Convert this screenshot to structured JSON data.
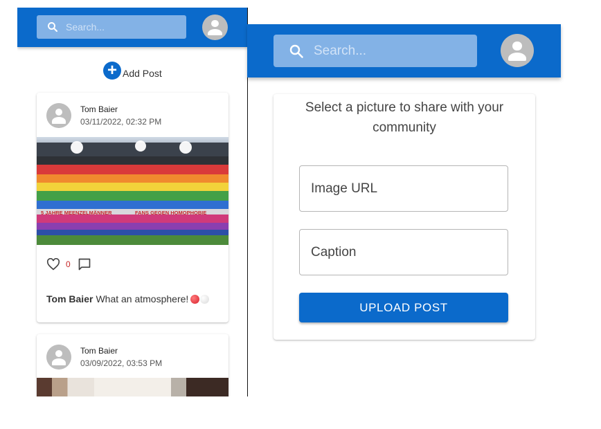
{
  "left": {
    "search": {
      "placeholder": "Search..."
    },
    "add_post_label": "Add Post",
    "posts": [
      {
        "author": "Tom Baier",
        "date": "03/11/2022, 02:32 PM",
        "likes": "0",
        "caption_author": "Tom Baier",
        "caption_text": "What an atmosphere!",
        "banner_text_1": "5 JAHRE MEENZELMÄNNER",
        "banner_text_2": "FANS GEGEN HOMOPHOBIE"
      },
      {
        "author": "Tom Baier",
        "date": "03/09/2022, 03:53 PM"
      }
    ]
  },
  "right": {
    "search": {
      "placeholder": "Search..."
    },
    "prompt": "Select a picture to share with your community",
    "image_url_placeholder": "Image URL",
    "caption_placeholder": "Caption",
    "upload_label": "UPLOAD POST"
  },
  "colors": {
    "primary": "#0b6acb",
    "search_bg": "#83b2e6",
    "like_count": "#c62828",
    "avatar_bg": "#bdbdbd"
  },
  "icons": [
    "search-icon",
    "account-icon",
    "add-circle-icon",
    "heart-outline-icon",
    "comment-outline-icon"
  ]
}
